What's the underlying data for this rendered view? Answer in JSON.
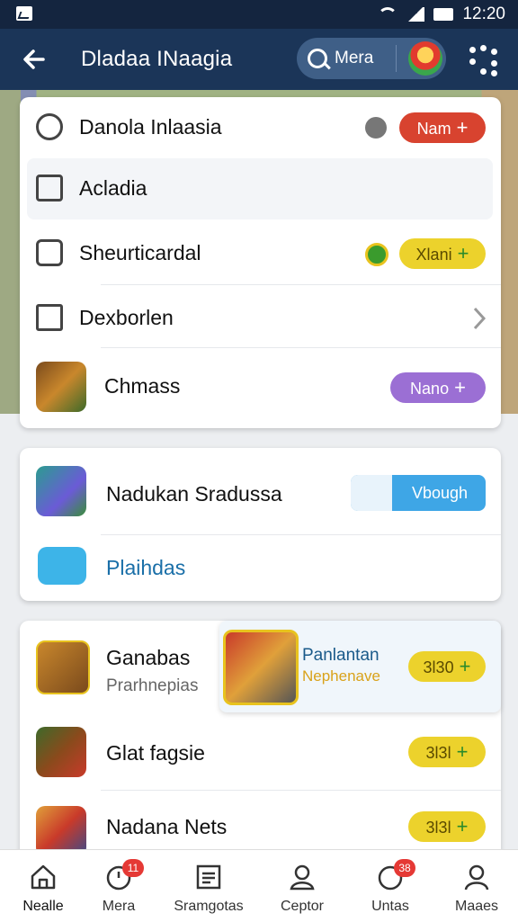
{
  "status_bar": {
    "time": "12:20"
  },
  "header": {
    "title": "Dladaa INaagia",
    "search_text": "Mera"
  },
  "card1": {
    "rows": [
      {
        "label": "Danola Inlaasia",
        "button": "Nam"
      },
      {
        "label": "Acladia"
      },
      {
        "label": "Sheurticardal",
        "button": "Xlani"
      },
      {
        "label": "Dexborlen"
      },
      {
        "label": "Chmass",
        "button": "Nano"
      }
    ]
  },
  "card2": {
    "rows": [
      {
        "label": "Nadukan Sradussa",
        "button": "Vbough"
      },
      {
        "label": "Plaihdas"
      }
    ]
  },
  "card3": {
    "rows": [
      {
        "label": "Ganabas",
        "sublabel": "Prarhnepias",
        "popup_title": "Panlantan",
        "popup_sub": "Nephenave",
        "button": "3l30"
      },
      {
        "label": "Glat fagsie",
        "button": "3l3l"
      },
      {
        "label": "Nadana Nets",
        "button": "3l3l"
      }
    ]
  },
  "bottom_nav": [
    {
      "label": "Nealle"
    },
    {
      "label": "Mera",
      "badge": "11"
    },
    {
      "label": "Sramgotas"
    },
    {
      "label": "Ceptor"
    },
    {
      "label": "Untas",
      "badge": "38"
    },
    {
      "label": "Maaes"
    }
  ],
  "colors": {
    "appbar": "#1b3558",
    "red_button": "#d8432f",
    "yellow_button": "#ecd22c",
    "purple_button": "#9b6fd4",
    "blue_button": "#3ea6e6"
  }
}
